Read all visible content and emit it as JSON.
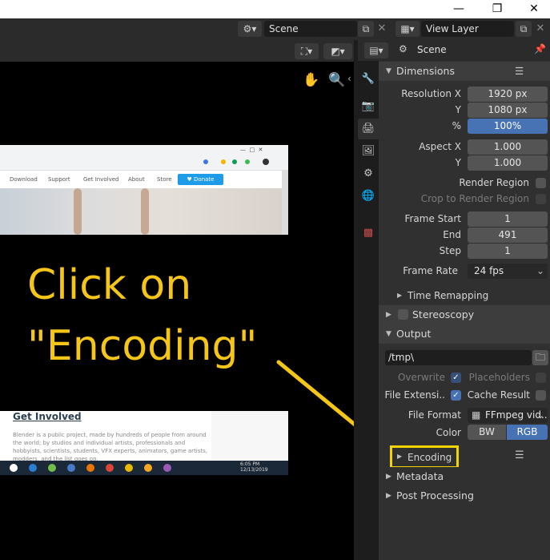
{
  "window": {
    "minimize": "—",
    "restore": "❐",
    "close": "✕"
  },
  "topbar": {
    "scene_label": "Scene",
    "view_layer_label": "View Layer"
  },
  "overlay": {
    "line1": "Click on",
    "line2": "\"Encoding\"",
    "color": "#f5c518"
  },
  "browser": {
    "nav": [
      "Download",
      "Support",
      "Get Involved",
      "About",
      "Store"
    ],
    "donate": "♥ Donate",
    "section_title": "Get Involved",
    "paragraph": "Blender is a public project, made by hundreds of people from around the world; by studios and individual artists, professionals and hobbyists, scientists, students, VFX experts, animators, game artists, modders, and the list goes on.",
    "time": "6:05 PM",
    "date": "12/13/2019"
  },
  "properties": {
    "header_title": "Scene",
    "dimensions": {
      "title": "Dimensions",
      "resolution_x_label": "Resolution X",
      "resolution_x": "1920 px",
      "y_label": "Y",
      "resolution_y": "1080 px",
      "pct_label": "%",
      "pct": "100%",
      "aspect_x_label": "Aspect X",
      "aspect_x": "1.000",
      "aspect_y_label": "Y",
      "aspect_y": "1.000",
      "render_region": "Render Region",
      "crop_region": "Crop to Render Region",
      "frame_start_label": "Frame Start",
      "frame_start": "1",
      "end_label": "End",
      "end": "491",
      "step_label": "Step",
      "step": "1",
      "frame_rate_label": "Frame Rate",
      "frame_rate": "24 fps",
      "time_remapping": "Time Remapping"
    },
    "stereoscopy": "Stereoscopy",
    "output": {
      "title": "Output",
      "path": "/tmp\\",
      "overwrite": "Overwrite",
      "placeholders": "Placeholders",
      "file_ext": "File Extensi..",
      "cache_result": "Cache Result",
      "file_format_label": "File Format",
      "file_format": "FFmpeg vid..",
      "color_label": "Color",
      "color_bw": "BW",
      "color_rgb": "RGB",
      "encoding": "Encoding"
    },
    "metadata": "Metadata",
    "post_processing": "Post Processing",
    "accent": "#4772b3"
  }
}
